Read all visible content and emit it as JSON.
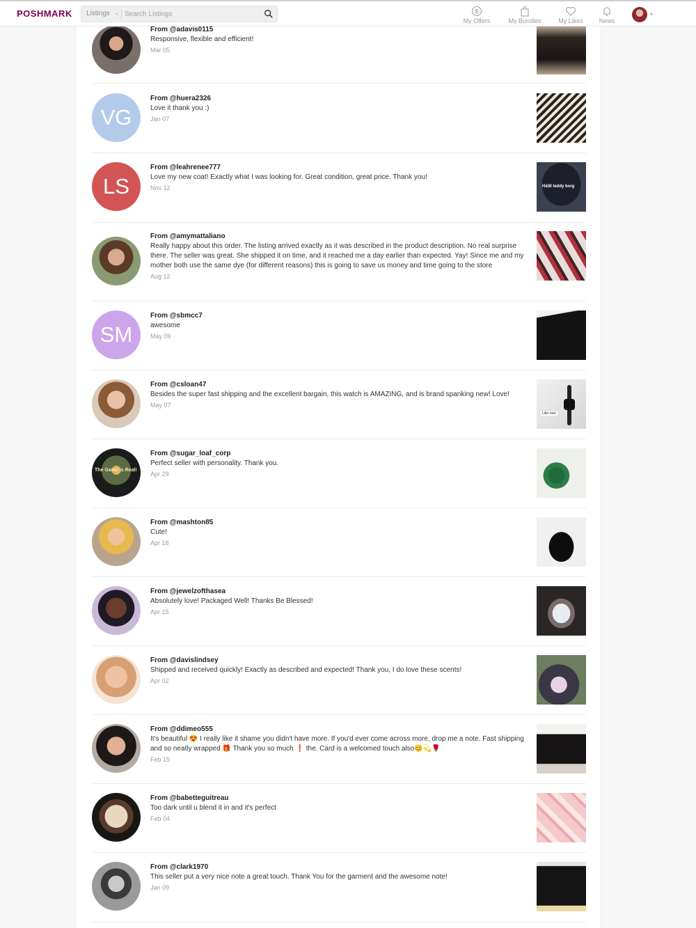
{
  "header": {
    "logo": "POSHMARK",
    "search": {
      "category": "Listings",
      "placeholder": "Search Listings"
    },
    "nav": [
      {
        "label": "My Offers",
        "icon": "dollar-icon"
      },
      {
        "label": "My Bundles",
        "icon": "bag-icon"
      },
      {
        "label": "My Likes",
        "icon": "heart-icon"
      },
      {
        "label": "News",
        "icon": "bell-icon"
      }
    ]
  },
  "colors": {
    "brand": "#7f0353",
    "avatar_vg": "#b3cbea",
    "avatar_ls": "#d25454",
    "avatar_sm": "#cda5ea"
  },
  "reviews": [
    {
      "from": "From @adavis0115",
      "text": "Responsive, flexible and efficient!",
      "date": "Mar 05",
      "avatar": "photo"
    },
    {
      "from": "From @huera2326",
      "text": "Love it thank you :)",
      "date": "Jan 07",
      "avatar": "VG"
    },
    {
      "from": "From @leahrenee777",
      "text": "Love my new coat! Exactly what I was looking for. Great condition, great price. Thank you!",
      "date": "Nov 12",
      "avatar": "LS",
      "item_caption": "H&M teddy borg"
    },
    {
      "from": "From @amymattaliano",
      "text": "Really happy about this order. The listing arrived exactly as it was described in the product description. No real surprise there. The seller was great. She shipped it on time, and it reached me a day earlier than expected. Yay! Since me and my mother both use the same dye (for different reasons) this is going to save us money and time going to the store",
      "date": "Aug 12",
      "avatar": "photo"
    },
    {
      "from": "From @sbmcc7",
      "text": "awesome",
      "date": "May 09",
      "avatar": "SM"
    },
    {
      "from": "From @csloan47",
      "text": "Besides the super fast shipping and the excellent bargain, this watch is AMAZING, and is brand spanking new! Love!",
      "date": "May 07",
      "avatar": "photo",
      "item_caption": "Like new"
    },
    {
      "from": "From @sugar_loaf_corp",
      "text": "Perfect seller with personality. Thank you.",
      "date": "Apr 29",
      "avatar": "photo",
      "avatar_caption": "The Game is Real!"
    },
    {
      "from": "From @mashton85",
      "text": "Cute!",
      "date": "Apr 18",
      "avatar": "photo"
    },
    {
      "from": "From @jewelzofthasea",
      "text": "Absolutely love! Packaged Well! Thanks Be Blessed!",
      "date": "Apr 15",
      "avatar": "photo"
    },
    {
      "from": "From @davislindsey",
      "text": "Shipped and received quickly! Exactly as described and expected! Thank you, I do love these scents!",
      "date": "Apr 02",
      "avatar": "photo"
    },
    {
      "from": "From @ddimeo555",
      "text": "It's beautiful 😍 I really like it shame you didn't have more. If you'd ever come across more, drop me a note. Fast shipping and so neatly wrapped 🎁 Thank you so much ❗ the. Card is a welcomed touch also😊💫🌹",
      "date": "Feb 15",
      "avatar": "photo"
    },
    {
      "from": "From @babetteguitreau",
      "text": "Too dark until u blend it in and it's perfect",
      "date": "Feb 04",
      "avatar": "photo"
    },
    {
      "from": "From @clark1970",
      "text": "This seller put a very nice note a great touch. Thank You for the garment and the awesome note!",
      "date": "Jan 09",
      "avatar": "photo"
    }
  ]
}
